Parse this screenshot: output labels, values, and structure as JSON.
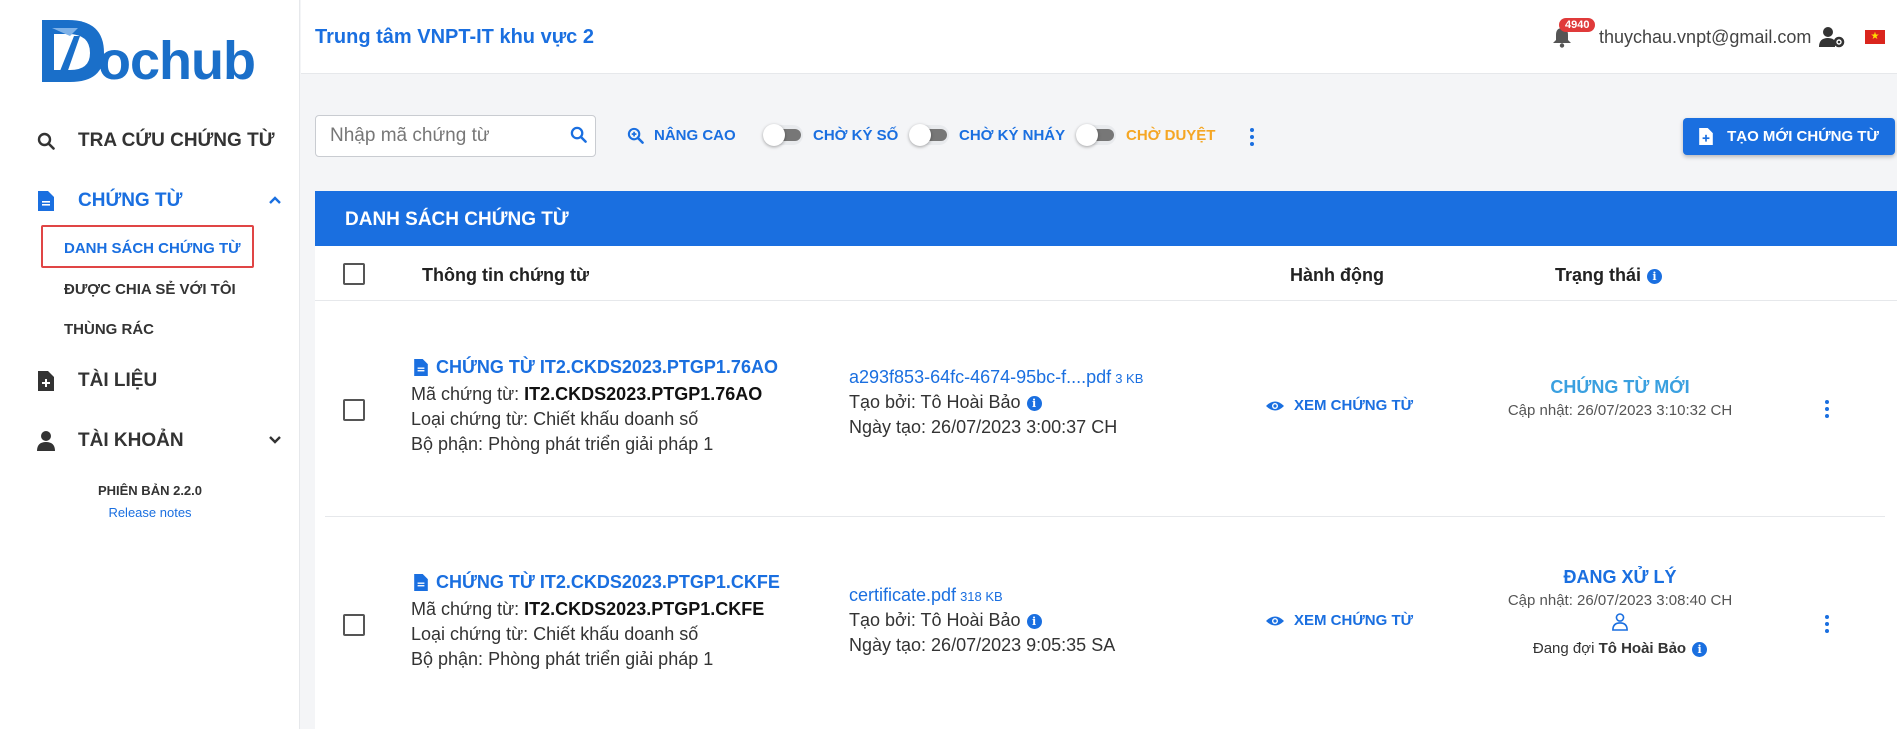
{
  "brand": {
    "logo_text": "ochub"
  },
  "sidebar": {
    "nav": [
      {
        "label": "TRA CỨU CHỨNG TỪ",
        "icon": "search-icon"
      },
      {
        "label": "CHỨNG TỪ",
        "icon": "document-icon"
      },
      {
        "label": "TÀI LIỆU",
        "icon": "file-plus-icon"
      },
      {
        "label": "TÀI KHOẢN",
        "icon": "person-icon"
      }
    ],
    "sub": [
      {
        "label": "DANH SÁCH CHỨNG TỪ"
      },
      {
        "label": "ĐƯỢC CHIA SẺ VỚI TÔI"
      },
      {
        "label": "THÙNG RÁC"
      }
    ],
    "version": "PHIÊN BẢN 2.2.0",
    "release_notes": "Release notes"
  },
  "header": {
    "org": "Trung tâm VNPT-IT khu vực 2",
    "notification_count": "4940",
    "email": "thuychau.vnpt@gmail.com"
  },
  "toolbar": {
    "search_placeholder": "Nhập mã chứng từ",
    "advanced": "NÂNG CAO",
    "toggles": [
      {
        "label": "CHỜ KÝ SỐ",
        "color": "#1a6fe0"
      },
      {
        "label": "CHỜ KÝ NHÁY",
        "color": "#1a6fe0"
      },
      {
        "label": "CHỜ DUYỆT",
        "color": "#f5a623"
      }
    ],
    "create_label": "TẠO MỚI CHỨNG TỪ"
  },
  "table": {
    "title": "DANH SÁCH CHỨNG TỪ",
    "columns": {
      "info": "Thông tin chứng từ",
      "action": "Hành động",
      "status": "Trạng thái"
    },
    "rows": [
      {
        "title": "CHỨNG TỪ IT2.CKDS2023.PTGP1.76AO",
        "code_label": "Mã chứng từ:",
        "code": "IT2.CKDS2023.PTGP1.76AO",
        "type": "Loại chứng từ: Chiết khấu doanh số",
        "dept": "Bộ phận: Phòng phát triển giải pháp 1",
        "file_name": "a293f853-64fc-4674-95bc-f....pdf",
        "file_size": "3 KB",
        "created_by": "Tạo bởi: Tô Hoài Bảo",
        "created_at": "Ngày tạo: 26/07/2023 3:00:37 CH",
        "action": "XEM CHỨNG TỪ",
        "status": "CHỨNG TỪ MỚI",
        "status_color": "#3aa0e0",
        "updated": "Cập nhật: 26/07/2023 3:10:32 CH"
      },
      {
        "title": "CHỨNG TỪ IT2.CKDS2023.PTGP1.CKFE",
        "code_label": "Mã chứng từ:",
        "code": "IT2.CKDS2023.PTGP1.CKFE",
        "type": "Loại chứng từ: Chiết khấu doanh số",
        "dept": "Bộ phận: Phòng phát triển giải pháp 1",
        "file_name": "certificate.pdf",
        "file_size": "318 KB",
        "created_by": "Tạo bởi: Tô Hoài Bảo",
        "created_at": "Ngày tạo: 26/07/2023 9:05:35 SA",
        "action": "XEM CHỨNG TỪ",
        "status": "ĐANG XỬ LÝ",
        "status_color": "#1a6fe0",
        "updated": "Cập nhật: 26/07/2023 3:08:40 CH",
        "waiting_label": "Đang đợi",
        "waiting_name": "Tô Hoài Bảo"
      }
    ]
  }
}
